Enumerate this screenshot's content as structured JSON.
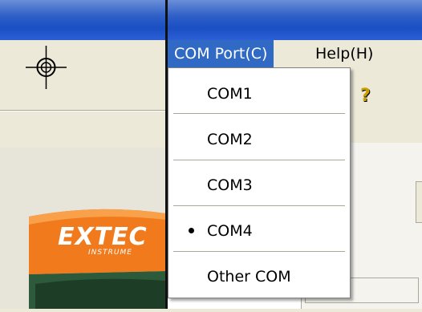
{
  "menubar": {
    "com_port_label": "COM Port(C)",
    "help_label": "Help(H)"
  },
  "com_menu": {
    "items": [
      {
        "label": "COM1",
        "checked": false
      },
      {
        "label": "COM2",
        "checked": false
      },
      {
        "label": "COM3",
        "checked": false
      },
      {
        "label": "COM4",
        "checked": true
      },
      {
        "label": "Other COM",
        "checked": false
      }
    ]
  },
  "device": {
    "brand": "EXTEC",
    "sub": "INSTRUME"
  },
  "icons": {
    "crosshair": "crosshair-icon",
    "help": "help-icon"
  },
  "colors": {
    "titlebar": "#2f5fc7",
    "menu_highlight": "#316ac5",
    "device_orange": "#f07a1c"
  }
}
